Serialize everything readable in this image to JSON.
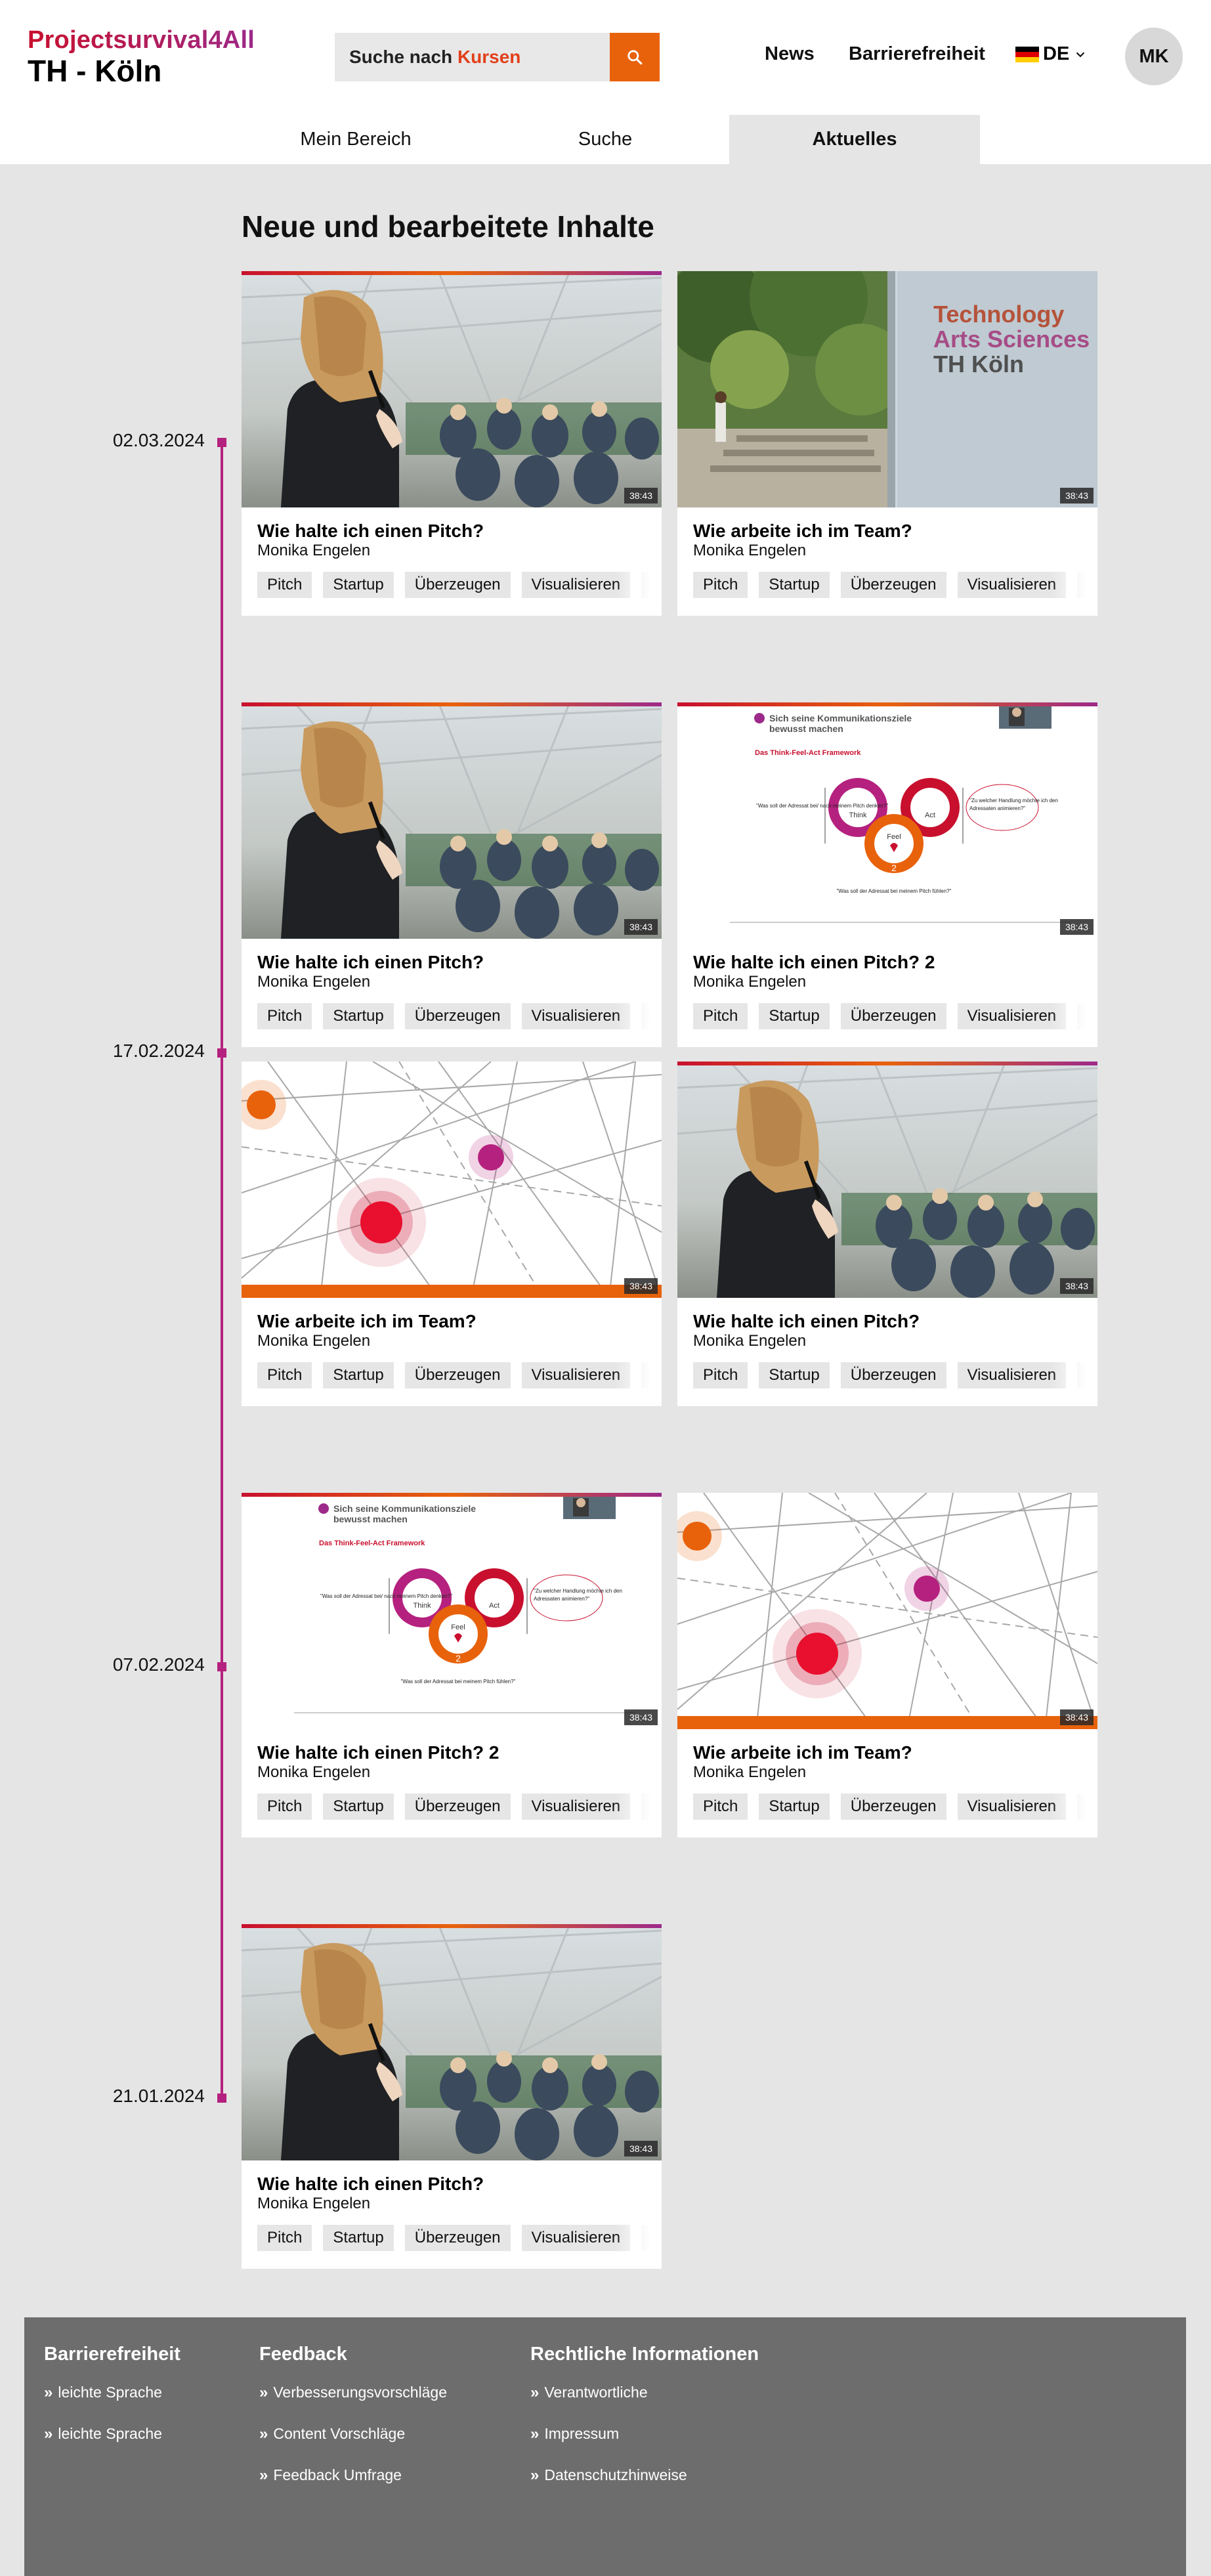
{
  "brand": {
    "line1": "Projectsurvival4All",
    "line2": "TH - Köln"
  },
  "search": {
    "prefix": "Suche nach ",
    "highlight": "Kursen",
    "icon": "search-icon"
  },
  "nav": {
    "news": "News",
    "accessibility": "Barrierefreiheit",
    "language": "DE",
    "avatar": "MK"
  },
  "tabs": [
    {
      "label": "Mein Bereich",
      "active": false
    },
    {
      "label": "Suche",
      "active": false
    },
    {
      "label": "Aktuelles",
      "active": true
    }
  ],
  "page_title": "Neue und bearbeitete Inhalte",
  "timeline": [
    {
      "date": "02.03.2024"
    },
    {
      "date": "17.02.2024"
    },
    {
      "date": "07.02.2024"
    },
    {
      "date": "21.01.2024"
    }
  ],
  "tags": [
    "Pitch",
    "Startup",
    "Überzeugen",
    "Visualisieren",
    "Vo"
  ],
  "cards": [
    {
      "title": "Wie halte ich einen Pitch?",
      "author": "Monika Engelen",
      "duration": "38:43",
      "thumb": "speaker"
    },
    {
      "title": "Wie arbeite ich im Team?",
      "author": "Monika Engelen",
      "duration": "38:43",
      "thumb": "campus"
    },
    {
      "title": "Wie halte ich einen Pitch?",
      "author": "Monika Engelen",
      "duration": "38:43",
      "thumb": "speaker"
    },
    {
      "title": "Wie halte ich einen Pitch? 2",
      "author": "Monika Engelen",
      "duration": "38:43",
      "thumb": "slide"
    },
    {
      "title": "Wie arbeite ich im Team?",
      "author": "Monika Engelen",
      "duration": "38:43",
      "thumb": "network"
    },
    {
      "title": "Wie halte ich einen Pitch?",
      "author": "Monika Engelen",
      "duration": "38:43",
      "thumb": "speaker"
    },
    {
      "title": "Wie halte ich einen Pitch? 2",
      "author": "Monika Engelen",
      "duration": "38:43",
      "thumb": "slide"
    },
    {
      "title": "Wie arbeite ich im Team?",
      "author": "Monika Engelen",
      "duration": "38:43",
      "thumb": "network"
    },
    {
      "title": "Wie halte ich einen Pitch?",
      "author": "Monika Engelen",
      "duration": "38:43",
      "thumb": "speaker"
    }
  ],
  "campus_sign": {
    "line1": "Technology",
    "line2": "Arts Sciences",
    "line3": "TH Köln"
  },
  "slide": {
    "heading": "Sich seine Kommunikationsziele bewusst machen",
    "subheading": "Das Think-Feel-Act Framework",
    "think": "Think",
    "feel": "Feel",
    "act": "Act",
    "q_think": "\"Was soll der Adressat bei/ nach meinem Pitch denken?\"",
    "q_act": "\"Zu welcher Handlung möchte ich den Adressaten bei/nach meinem Pitch animieren?\"",
    "q_feel": "\"Was soll der Adressat bei meinem Pitch fühlen?\""
  },
  "footer": {
    "col1": {
      "title": "Barrierefreiheit",
      "links": [
        "leichte Sprache",
        "leichte Sprache"
      ]
    },
    "col2": {
      "title": "Feedback",
      "links": [
        "Verbesserungsvorschläge",
        "Content Vorschläge",
        "Feedback Umfrage"
      ]
    },
    "col3": {
      "title": "Rechtliche Informationen",
      "links": [
        "Verantwortliche",
        "Impressum",
        "Datenschutzhinweise"
      ]
    }
  },
  "colors": {
    "accent": "#e8620c",
    "magenta": "#b5217e",
    "red": "#c8102e",
    "footer": "#6d6d6d"
  }
}
